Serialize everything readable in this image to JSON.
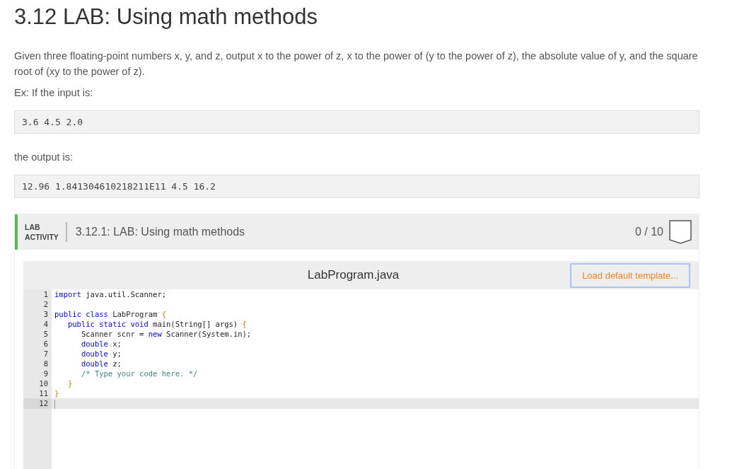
{
  "title": "3.12 LAB: Using math methods",
  "description": "Given three floating-point numbers x, y, and z, output x to the power of z, x to the power of (y to the power of z), the absolute value of y, and the square root of (xy to the power of z).",
  "input_intro": "Ex: If the input is:",
  "input_example": "3.6 4.5 2.0",
  "output_intro": "the output is:",
  "output_example": "12.96 1.841304610218211E11 4.5 16.2",
  "lab": {
    "label_line_1": "LAB",
    "label_line_2": "ACTIVITY",
    "name": "3.12.1: LAB: Using math methods",
    "score": "0 / 10",
    "editor": {
      "filename": "LabProgram.java",
      "template_button": "Load default template...",
      "lines": [
        {
          "number": "1",
          "current": false,
          "tokens": [
            {
              "kind": "keyword",
              "text": "import"
            },
            {
              "kind": "plain",
              "text": " java.util.Scanner;"
            }
          ]
        },
        {
          "number": "2",
          "current": false
        },
        {
          "number": "3",
          "current": false,
          "tokens": [
            {
              "kind": "keyword",
              "text": "public class"
            },
            {
              "kind": "plain",
              "text": " LabProgram "
            },
            {
              "kind": "brace",
              "text": "{"
            }
          ]
        },
        {
          "number": "4",
          "current": false,
          "tokens": [
            {
              "kind": "keyword",
              "text": "   public static void"
            },
            {
              "kind": "plain",
              "text": " main(String[] args) "
            },
            {
              "kind": "brace",
              "text": "{"
            }
          ]
        },
        {
          "number": "5",
          "current": false,
          "tokens": [
            {
              "kind": "plain",
              "text": "      Scanner scnr = "
            },
            {
              "kind": "keyword",
              "text": "new"
            },
            {
              "kind": "plain",
              "text": " Scanner(System.in);"
            }
          ]
        },
        {
          "number": "6",
          "current": false,
          "tokens": [
            {
              "kind": "keyword",
              "text": "      double"
            },
            {
              "kind": "plain",
              "text": " x;"
            }
          ]
        },
        {
          "number": "7",
          "current": false,
          "tokens": [
            {
              "kind": "keyword",
              "text": "      double"
            },
            {
              "kind": "plain",
              "text": " y;"
            }
          ]
        },
        {
          "number": "8",
          "current": false,
          "tokens": [
            {
              "kind": "keyword",
              "text": "      double"
            },
            {
              "kind": "plain",
              "text": " z;"
            }
          ]
        },
        {
          "number": "9",
          "current": false,
          "tokens": [
            {
              "kind": "comment",
              "text": "      /* Type your code here. */"
            }
          ]
        },
        {
          "number": "10",
          "current": false,
          "tokens": [
            {
              "kind": "brace",
              "text": "   }"
            }
          ]
        },
        {
          "number": "11",
          "current": false,
          "tokens": [
            {
              "kind": "brace",
              "text": "}"
            }
          ]
        },
        {
          "number": "12",
          "current": true
        }
      ]
    }
  }
}
